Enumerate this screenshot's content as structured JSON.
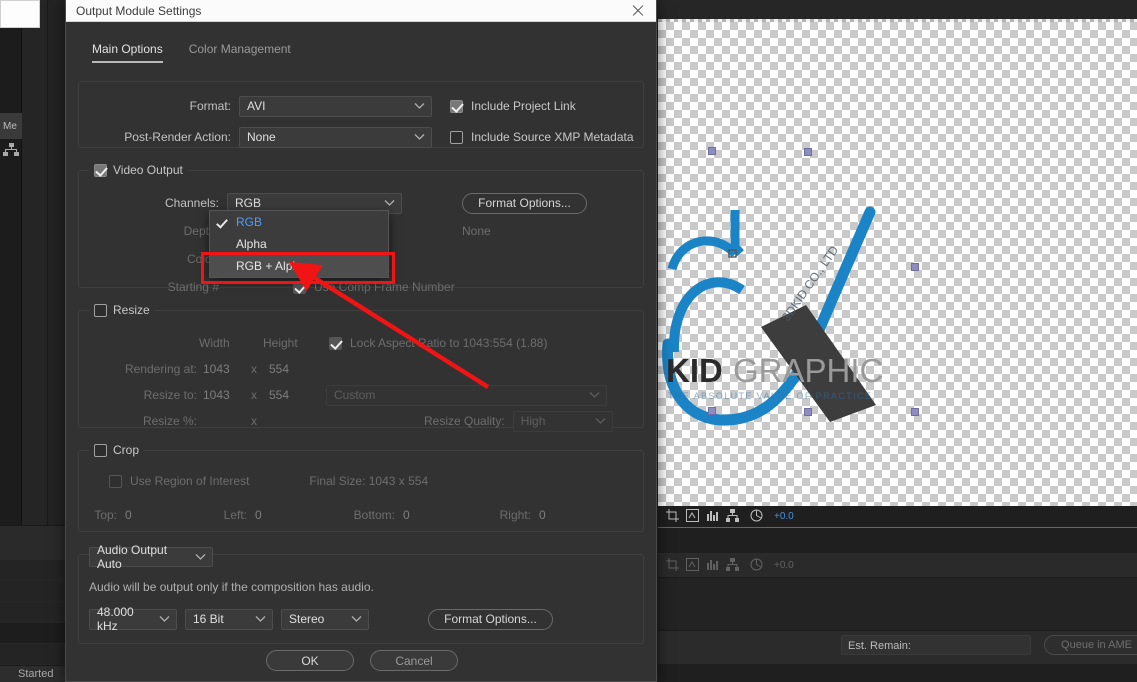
{
  "dialog": {
    "title": "Output Module Settings",
    "close_icon": "close-icon",
    "tabs": [
      {
        "label": "Main Options",
        "active": true
      },
      {
        "label": "Color Management",
        "active": false
      }
    ],
    "format_group": {
      "format_label": "Format:",
      "format_value": "AVI",
      "post_render_label": "Post-Render Action:",
      "post_render_value": "None",
      "include_project_link": {
        "label": "Include Project Link",
        "checked": true
      },
      "include_xmp": {
        "label": "Include Source XMP Metadata",
        "checked": false
      }
    },
    "video_output": {
      "legend": "Video Output",
      "legend_checked": true,
      "channels_label": "Channels:",
      "channels_value": "RGB",
      "depth_label": "Depth:",
      "color_label": "Color:",
      "starting_label": "Starting #",
      "use_comp_frame_number": "Use Comp Frame Number",
      "format_options_button": "Format Options...",
      "format_options_value": "None",
      "dropdown_open": true,
      "dropdown_items": [
        {
          "label": "RGB",
          "checked": true,
          "highlighted": false
        },
        {
          "label": "Alpha",
          "checked": false,
          "highlighted": false
        },
        {
          "label": "RGB + Alpha",
          "checked": false,
          "highlighted": true
        }
      ]
    },
    "resize": {
      "legend": "Resize",
      "legend_checked": false,
      "width_header": "Width",
      "height_header": "Height",
      "lock_aspect": {
        "label": "Lock Aspect Ratio to 1043:554 (1.88)",
        "checked": true
      },
      "rendering_at_label": "Rendering at:",
      "rendering_at_w": "1043",
      "rendering_at_x": "x",
      "rendering_at_h": "554",
      "resize_to_label": "Resize to:",
      "resize_to_w": "1043",
      "resize_to_x": "x",
      "resize_to_h": "554",
      "resize_preset": "Custom",
      "resize_pct_label": "Resize %:",
      "resize_pct_x": "x",
      "resize_quality_label": "Resize Quality:",
      "resize_quality_value": "High"
    },
    "crop": {
      "legend": "Crop",
      "legend_checked": false,
      "use_region_of_interest": {
        "label": "Use Region of Interest",
        "checked": false
      },
      "final_size": "Final Size: 1043 x 554",
      "top_label": "Top:",
      "top_value": "0",
      "left_label": "Left:",
      "left_value": "0",
      "bottom_label": "Bottom:",
      "bottom_value": "0",
      "right_label": "Right:",
      "right_value": "0"
    },
    "audio": {
      "mode": "Audio Output Auto",
      "note": "Audio will be output only if the composition has audio.",
      "sample_rate": "48.000 kHz",
      "bit_depth": "16 Bit",
      "channels": "Stereo",
      "format_options_button": "Format Options..."
    },
    "footer": {
      "ok": "OK",
      "cancel": "Cancel"
    },
    "annotation": {
      "highlight_color": "#f01414",
      "arrow_color": "#f01414"
    }
  },
  "background": {
    "left_panel_fragment": "Me",
    "status_text": "Started",
    "render_queue": {
      "row_icons": [
        "crop-icon",
        "channel-icon",
        "histogram-icon",
        "hierarchy-icon",
        "shutter-icon"
      ],
      "exposure_a": "+0.0",
      "exposure_b": "+0.0"
    },
    "footer": {
      "est_remain_label": "Est. Remain:",
      "queue_in_ame": "Queue in AME"
    },
    "logo": {
      "primary_text": "KID",
      "secondary_text": "GRAPHIC",
      "rotated_text": "3DKID CO., LTD",
      "tagline": "THE ABSOLUTE VALUE OF PRACTICE",
      "blue": "#1a84c7",
      "dark": "#3d3d3d"
    }
  }
}
